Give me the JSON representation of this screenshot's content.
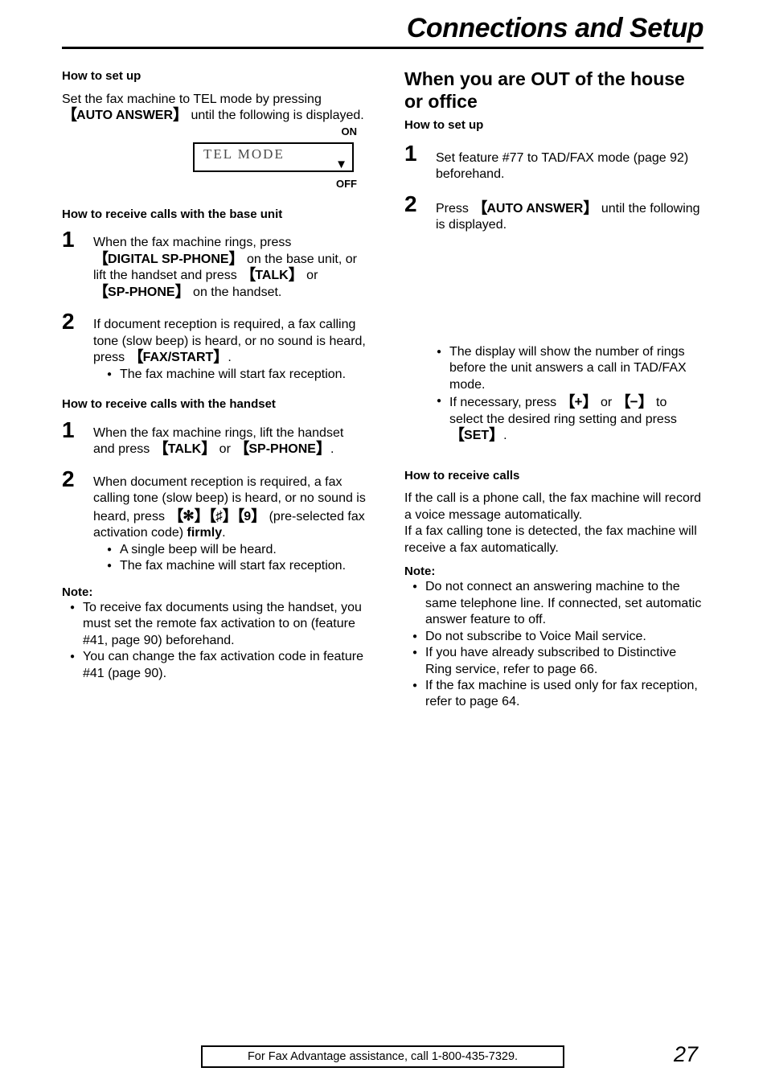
{
  "header": {
    "title": "Connections and Setup"
  },
  "left_column": {
    "setup": {
      "heading": "How to set up",
      "paragraph_part1": "Set the fax machine to TEL mode by pressing ",
      "auto_answer_key": "AUTO ANSWER",
      "paragraph_part2": " until the following is displayed."
    },
    "lcd": {
      "on_label": "ON",
      "off_label": "OFF",
      "display_text": "TEL MODE",
      "arrow_icon": "down-triangle"
    },
    "base_unit": {
      "heading": "How to receive calls with the base unit",
      "steps": [
        {
          "number": "1",
          "t1": "When the fax machine rings, press ",
          "k1": "DIGITAL SP-PHONE",
          "t2": " on the base unit, or lift the handset and press ",
          "k2": "TALK",
          "t3": " or ",
          "k3": "SP-PHONE",
          "t4": " on the handset."
        },
        {
          "number": "2",
          "t1": "If document reception is required, a fax calling tone (slow beep) is heard, or no sound is heard, press ",
          "k1": "FAX/START",
          "t2": ".",
          "bullets": [
            "The fax machine will start fax reception."
          ]
        }
      ]
    },
    "handset": {
      "heading": "How to receive calls with the handset",
      "steps": [
        {
          "number": "1",
          "t1": "When the fax machine rings, lift the handset and press ",
          "k1": "TALK",
          "t2": " or ",
          "k2": "SP-PHONE",
          "t3": "."
        },
        {
          "number": "2",
          "t1": "When document reception is required, a fax calling tone (slow beep) is heard, or no sound is heard, press ",
          "code_star": "✻",
          "code_hash": "♯",
          "code_nine": "9",
          "t2": " (pre-selected fax activation code) ",
          "bold_word": "firmly",
          "t3": ".",
          "bullets": [
            "A single beep will be heard.",
            "The fax machine will start fax reception."
          ]
        }
      ]
    },
    "note": {
      "label": "Note:",
      "bullets": [
        "To receive fax documents using the handset, you must set the remote fax activation to on (feature #41, page 90) beforehand.",
        "You can change the fax activation code in feature #41 (page 90)."
      ]
    }
  },
  "right_column": {
    "section_heading": "When you are OUT of the house or office",
    "setup": {
      "heading": "How to set up",
      "steps": [
        {
          "number": "1",
          "t1": "Set feature #77 to TAD/FAX mode (page 92) beforehand."
        },
        {
          "number": "2",
          "t1": "Press ",
          "k1": "AUTO ANSWER",
          "t2": " until the following is displayed."
        }
      ],
      "bullets": [
        {
          "t1": "The display will show the number of rings before the unit answers a call in TAD/FAX mode."
        },
        {
          "t1": "If necessary, press ",
          "k1": "+",
          "t2": " or ",
          "k2": "−",
          "t3": " to select the desired ring setting and press ",
          "k3": "SET",
          "t4": "."
        }
      ]
    },
    "receive": {
      "heading": "How to receive calls",
      "paragraph1": "If the call is a phone call, the fax machine will record a voice message automatically.",
      "paragraph2": "If a fax calling tone is detected, the fax machine will receive a fax automatically."
    },
    "note": {
      "label": "Note:",
      "bullets": [
        "Do not connect an answering machine to the same telephone line. If connected, set automatic answer feature to off.",
        "Do not subscribe to Voice Mail service.",
        "If you have already subscribed to Distinctive Ring service, refer to page 66.",
        "If the fax machine is used only for fax reception, refer to page 64."
      ]
    }
  },
  "footer": {
    "assistance_text": "For Fax Advantage assistance, call 1-800-435-7329.",
    "page_number": "27"
  }
}
